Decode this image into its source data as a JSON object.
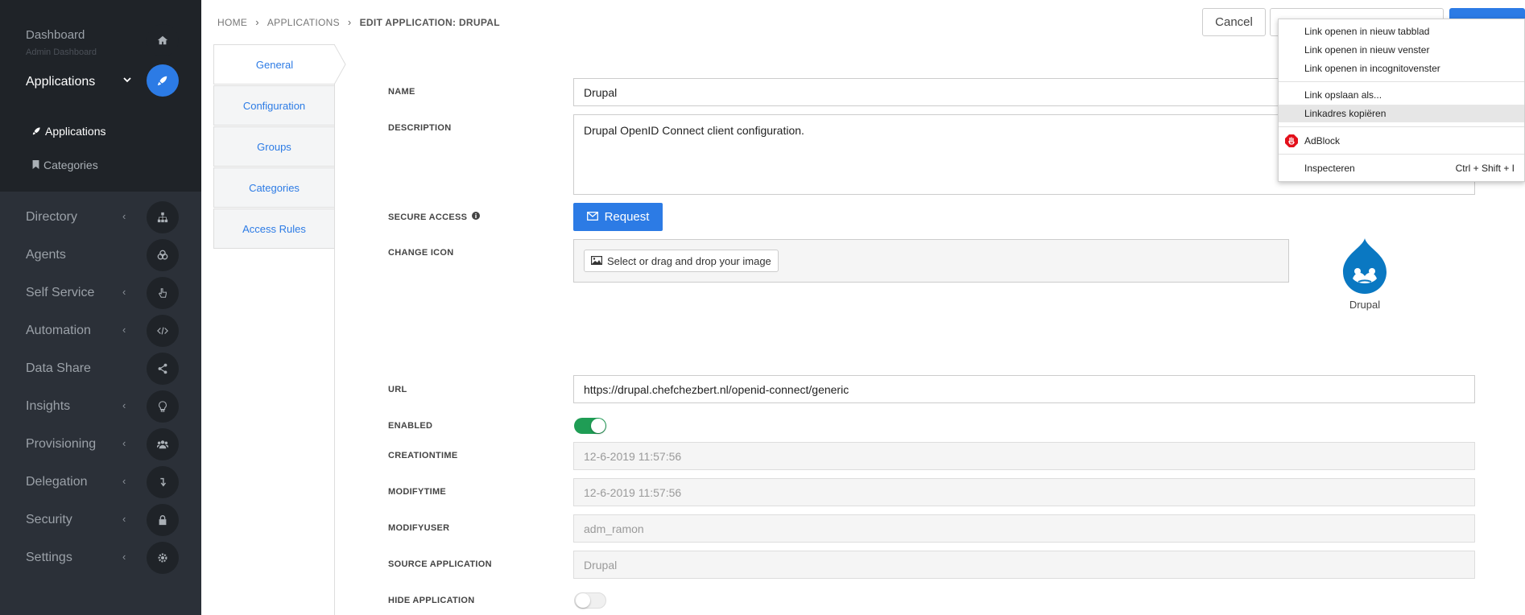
{
  "sidebar": {
    "dashboard": {
      "label": "Dashboard",
      "sub": "Admin Dashboard"
    },
    "applications": {
      "label": "Applications"
    },
    "subitems": [
      {
        "label": "Applications"
      },
      {
        "label": "Categories"
      }
    ],
    "items": [
      {
        "label": "Directory",
        "icon": "sitemap-icon"
      },
      {
        "label": "Agents",
        "icon": "agents-icon"
      },
      {
        "label": "Self Service",
        "icon": "hand-pointer-icon"
      },
      {
        "label": "Automation",
        "icon": "code-icon"
      },
      {
        "label": "Data Share",
        "icon": "share-icon"
      },
      {
        "label": "Insights",
        "icon": "lightbulb-icon"
      },
      {
        "label": "Provisioning",
        "icon": "users-icon"
      },
      {
        "label": "Delegation",
        "icon": "level-down-icon"
      },
      {
        "label": "Security",
        "icon": "lock-icon"
      },
      {
        "label": "Settings",
        "icon": "gear-icon"
      }
    ]
  },
  "breadcrumb": {
    "home": "HOME",
    "applications": "APPLICATIONS",
    "current": "EDIT APPLICATION: DRUPAL"
  },
  "header": {
    "cancel": "Cancel"
  },
  "tabs": [
    "General",
    "Configuration",
    "Groups",
    "Categories",
    "Access Rules"
  ],
  "form": {
    "name_label": "NAME",
    "name_value": "Drupal",
    "description_label": "DESCRIPTION",
    "description_value": "Drupal OpenID Connect client configuration.",
    "secure_access_label": "SECURE ACCESS",
    "request_button": "Request",
    "change_icon_label": "CHANGE ICON",
    "drop_button": "Select or drag and drop your image",
    "icon_caption": "Drupal",
    "url_label": "URL",
    "url_value": "https://drupal.chefchezbert.nl/openid-connect/generic",
    "enabled_label": "ENABLED",
    "enabled": true,
    "creationtime_label": "CREATIONTIME",
    "creationtime_value": "12-6-2019 11:57:56",
    "modifytime_label": "MODIFYTIME",
    "modifytime_value": "12-6-2019 11:57:56",
    "modifyuser_label": "MODIFYUSER",
    "modifyuser_value": "adm_ramon",
    "source_application_label": "SOURCE APPLICATION",
    "source_application_value": "Drupal",
    "hide_application_label": "HIDE APPLICATION",
    "hide_application": false
  },
  "context_menu": {
    "items": [
      "Link openen in nieuw tabblad",
      "Link openen in nieuw venster",
      "Link openen in incognitovenster",
      "Link opslaan als...",
      "Linkadres kopiëren",
      "AdBlock",
      "Inspecteren"
    ],
    "shortcut": "Ctrl + Shift + I"
  },
  "colors": {
    "accent": "#2c7be5",
    "toggle_on": "#1f9d55",
    "sidebar_bg": "#2b3038"
  }
}
